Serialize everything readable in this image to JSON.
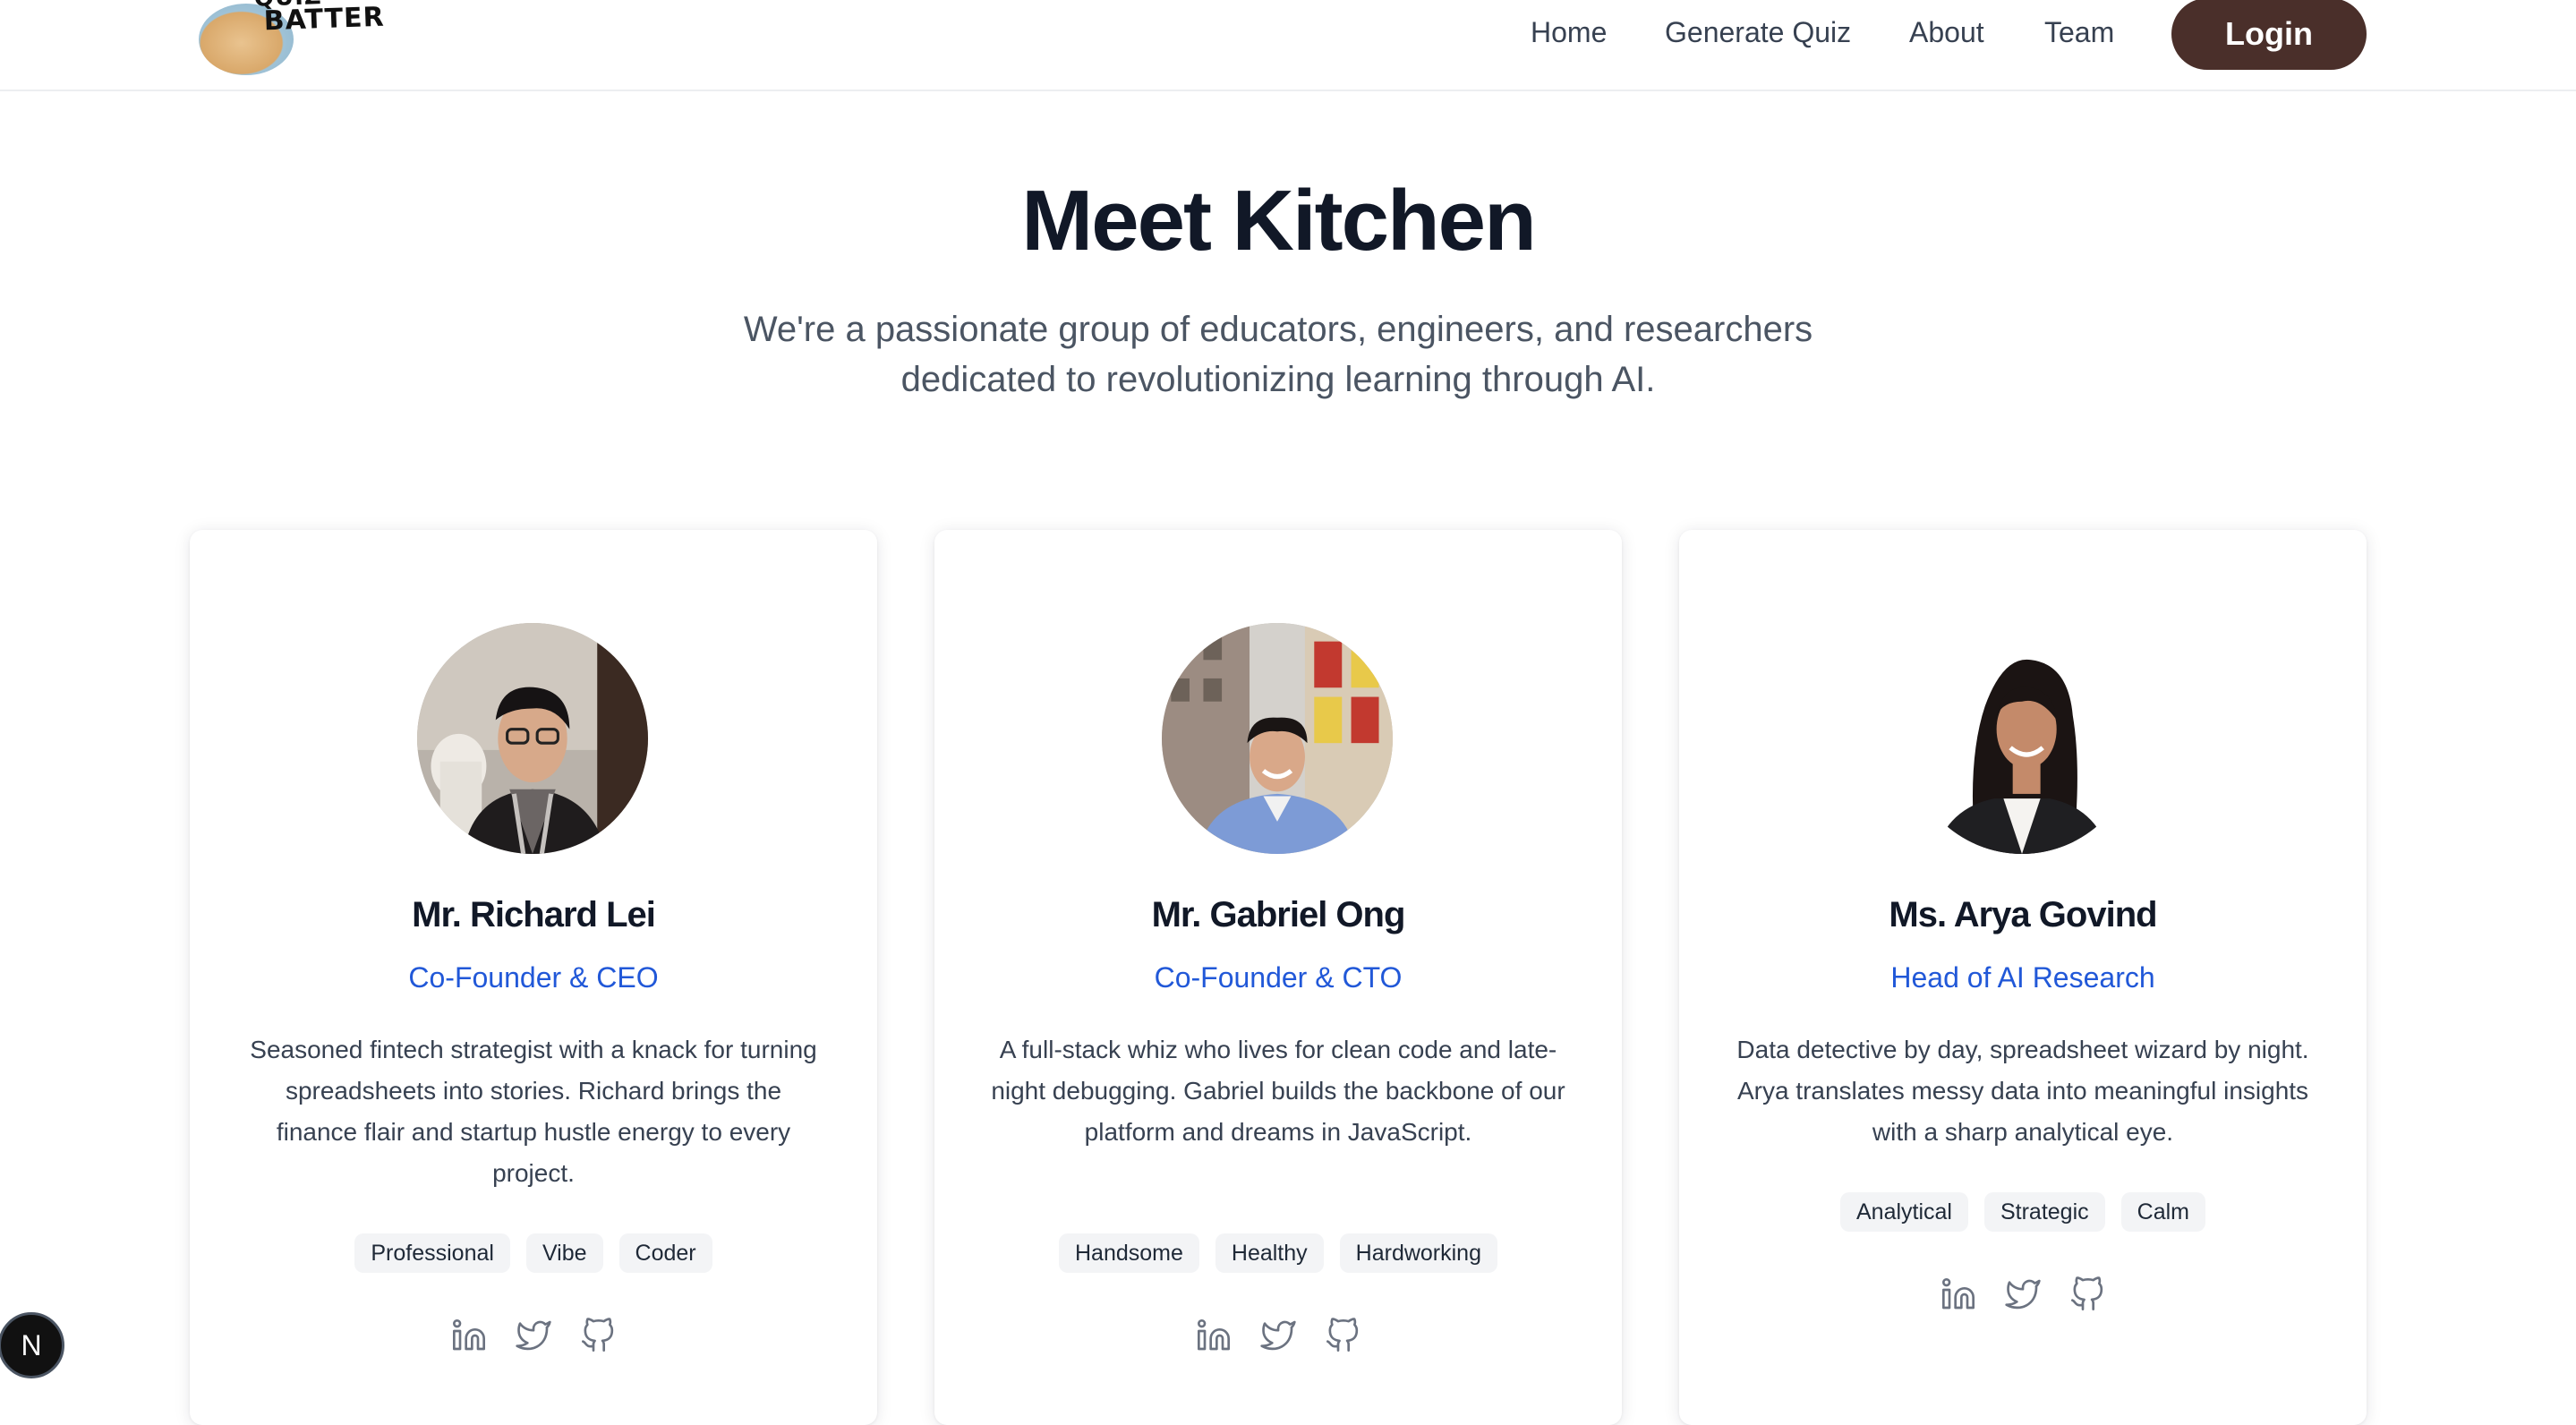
{
  "header": {
    "logo_top": "QUIZ",
    "logo_bottom": "BATTER",
    "nav": {
      "home": "Home",
      "generate": "Generate Quiz",
      "about": "About",
      "team": "Team",
      "login": "Login"
    }
  },
  "hero": {
    "title": "Meet Kitchen",
    "subtitle": "We're a passionate group of educators, engineers, and researchers dedicated to revolutionizing learning through AI."
  },
  "team": [
    {
      "name": "Mr. Richard Lei",
      "role": "Co-Founder & CEO",
      "bio": "Seasoned fintech strategist with a knack for turning spreadsheets into stories. Richard brings the finance flair and startup hustle energy to every project.",
      "tags": [
        "Professional",
        "Vibe",
        "Coder"
      ],
      "socials": [
        "linkedin-icon",
        "twitter-icon",
        "github-icon"
      ]
    },
    {
      "name": "Mr. Gabriel Ong",
      "role": "Co-Founder & CTO",
      "bio": "A full-stack whiz who lives for clean code and late-night debugging. Gabriel builds the backbone of our platform and dreams in JavaScript.",
      "tags": [
        "Handsome",
        "Healthy",
        "Hardworking"
      ],
      "socials": [
        "linkedin-icon",
        "twitter-icon",
        "github-icon"
      ]
    },
    {
      "name": "Ms. Arya Govind",
      "role": "Head of AI Research",
      "bio": "Data detective by day, spreadsheet wizard by night. Arya translates messy data into meaningful insights with a sharp analytical eye.",
      "tags": [
        "Analytical",
        "Strategic",
        "Calm"
      ],
      "socials": [
        "linkedin-icon",
        "twitter-icon",
        "github-icon"
      ]
    }
  ],
  "badge": "N",
  "colors": {
    "accent": "#2158d8",
    "login_bg": "#4a2f2a",
    "title": "#111827",
    "tag_bg": "#f3f4f6"
  }
}
